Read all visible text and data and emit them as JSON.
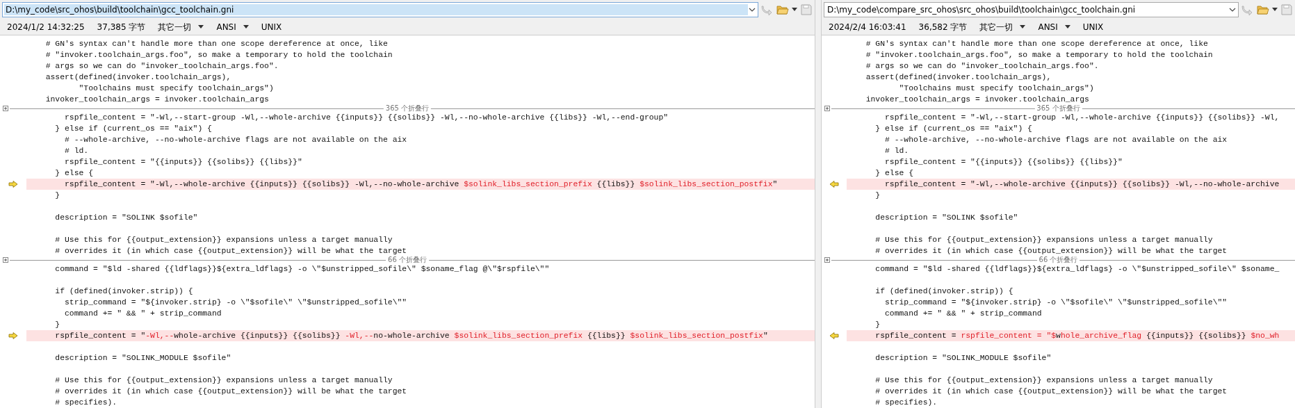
{
  "panes": [
    {
      "kind": "left",
      "active": true,
      "path": "D:\\my_code\\src_ohos\\build\\toolchain\\gcc_toolchain.gni",
      "date": "2024/1/2 14:32:25",
      "size": "37,385 字节",
      "filter": "其它一切",
      "encoding": "ANSI",
      "line_ending": "UNIX",
      "blocks": [
        {
          "kind": "code",
          "lines": [
            {
              "changed": false,
              "text": "  # GN's syntax can't handle more than one scope dereference at once, like"
            },
            {
              "changed": false,
              "text": "  # \"invoker.toolchain_args.foo\", so make a temporary to hold the toolchain"
            },
            {
              "changed": false,
              "text": "  # args so we can do \"invoker_toolchain_args.foo\"."
            },
            {
              "changed": false,
              "text": "  assert(defined(invoker.toolchain_args),"
            },
            {
              "changed": false,
              "text": "         \"Toolchains must specify toolchain_args\")"
            },
            {
              "changed": false,
              "text": "  invoker_toolchain_args = invoker.toolchain_args"
            }
          ]
        },
        {
          "kind": "fold",
          "label": "365 个折叠行"
        },
        {
          "kind": "code",
          "lines": [
            {
              "changed": false,
              "text": "      rspfile_content = \"-Wl,--start-group -Wl,--whole-archive {{inputs}} {{solibs}} -Wl,--no-whole-archive {{libs}} -Wl,--end-group\""
            },
            {
              "changed": false,
              "text": "    } else if (current_os == \"aix\") {"
            },
            {
              "changed": false,
              "text": "      # --whole-archive, --no-whole-archive flags are not available on the aix"
            },
            {
              "changed": false,
              "text": "      # ld."
            },
            {
              "changed": false,
              "text": "      rspfile_content = \"{{inputs}} {{solibs}} {{libs}}\""
            },
            {
              "changed": false,
              "text": "    } else {"
            },
            {
              "changed": true,
              "segments": [
                {
                  "text": "      rspfile_content = \"-Wl,--whole-archive {{inputs}} {{solibs}} -Wl,--no-whole-archive ",
                  "changed": false
                },
                {
                  "text": "$solink_libs_section_prefix",
                  "changed": true
                },
                {
                  "text": " {{libs}} ",
                  "changed": false
                },
                {
                  "text": "$solink_libs_section_postfix",
                  "changed": true
                },
                {
                  "text": "\"",
                  "changed": false
                }
              ]
            },
            {
              "changed": false,
              "text": "    }"
            },
            {
              "changed": false
            },
            {
              "changed": false,
              "text": "    description = \"SOLINK $sofile\""
            },
            {
              "changed": false
            },
            {
              "changed": false,
              "text": "    # Use this for {{output_extension}} expansions unless a target manually"
            },
            {
              "changed": false,
              "text": "    # overrides it (in which case {{output_extension}} will be what the target"
            }
          ]
        },
        {
          "kind": "fold",
          "label": "66 个折叠行"
        },
        {
          "kind": "code",
          "lines": [
            {
              "changed": false,
              "text": "    command = \"$ld -shared {{ldflags}}${extra_ldflags} -o \\\"$unstripped_sofile\\\" $soname_flag @\\\"$rspfile\\\"\""
            },
            {
              "changed": false
            },
            {
              "changed": false,
              "text": "    if (defined(invoker.strip)) {"
            },
            {
              "changed": false,
              "text": "      strip_command = \"${invoker.strip} -o \\\"$sofile\\\" \\\"$unstripped_sofile\\\"\""
            },
            {
              "changed": false,
              "text": "      command += \" && \" + strip_command"
            },
            {
              "changed": false,
              "text": "    }"
            },
            {
              "changed": true,
              "segments": [
                {
                  "text": "    rspfile_content = \"",
                  "changed": false
                },
                {
                  "text": "-Wl,--",
                  "changed": true
                },
                {
                  "text": "whole-archive {{inputs}} {{solibs}} ",
                  "changed": false
                },
                {
                  "text": "-Wl,--",
                  "changed": true
                },
                {
                  "text": "no-whole-archive ",
                  "changed": false
                },
                {
                  "text": "$solink_libs_section_prefix",
                  "changed": true
                },
                {
                  "text": " {{libs}} ",
                  "changed": false
                },
                {
                  "text": "$solink_libs_section_postfix",
                  "changed": true
                },
                {
                  "text": "\"",
                  "changed": false
                }
              ]
            },
            {
              "changed": false
            },
            {
              "changed": false,
              "text": "    description = \"SOLINK_MODULE $sofile\""
            },
            {
              "changed": false
            },
            {
              "changed": false,
              "text": "    # Use this for {{output_extension}} expansions unless a target manually"
            },
            {
              "changed": false,
              "text": "    # overrides it (in which case {{output_extension}} will be what the target"
            },
            {
              "changed": false,
              "text": "    # specifies)."
            }
          ]
        }
      ]
    },
    {
      "kind": "right",
      "active": false,
      "path": "D:\\my_code\\compare_src_ohos\\src_ohos\\build\\toolchain\\gcc_toolchain.gni",
      "date": "2024/2/4 16:03:41",
      "size": "36,582 字节",
      "filter": "其它一切",
      "encoding": "ANSI",
      "line_ending": "UNIX",
      "blocks": [
        {
          "kind": "code",
          "lines": [
            {
              "changed": false,
              "text": "  # GN's syntax can't handle more than one scope dereference at once, like"
            },
            {
              "changed": false,
              "text": "  # \"invoker.toolchain_args.foo\", so make a temporary to hold the toolchain"
            },
            {
              "changed": false,
              "text": "  # args so we can do \"invoker_toolchain_args.foo\"."
            },
            {
              "changed": false,
              "text": "  assert(defined(invoker.toolchain_args),"
            },
            {
              "changed": false,
              "text": "         \"Toolchains must specify toolchain_args\")"
            },
            {
              "changed": false,
              "text": "  invoker_toolchain_args = invoker.toolchain_args"
            }
          ]
        },
        {
          "kind": "fold",
          "label": "365 个折叠行"
        },
        {
          "kind": "code",
          "lines": [
            {
              "changed": false,
              "text": "      rspfile_content = \"-Wl,--start-group -Wl,--whole-archive {{inputs}} {{solibs}} -Wl,"
            },
            {
              "changed": false,
              "text": "    } else if (current_os == \"aix\") {"
            },
            {
              "changed": false,
              "text": "      # --whole-archive, --no-whole-archive flags are not available on the aix"
            },
            {
              "changed": false,
              "text": "      # ld."
            },
            {
              "changed": false,
              "text": "      rspfile_content = \"{{inputs}} {{solibs}} {{libs}}\""
            },
            {
              "changed": false,
              "text": "    } else {"
            },
            {
              "changed": true,
              "segments": [
                {
                  "text": "      rspfile_content = \"-Wl,--whole-archive {{inputs}} {{solibs}} -Wl,--no-whole-archive",
                  "changed": false
                }
              ]
            },
            {
              "changed": false,
              "text": "    }"
            },
            {
              "changed": false
            },
            {
              "changed": false,
              "text": "    description = \"SOLINK $sofile\""
            },
            {
              "changed": false
            },
            {
              "changed": false,
              "text": "    # Use this for {{output_extension}} expansions unless a target manually"
            },
            {
              "changed": false,
              "text": "    # overrides it (in which case {{output_extension}} will be what the target"
            }
          ]
        },
        {
          "kind": "fold",
          "label": "66 个折叠行"
        },
        {
          "kind": "code",
          "lines": [
            {
              "changed": false,
              "text": "    command = \"$ld -shared {{ldflags}}${extra_ldflags} -o \\\"$unstripped_sofile\\\" $soname_"
            },
            {
              "changed": false
            },
            {
              "changed": false,
              "text": "    if (defined(invoker.strip)) {"
            },
            {
              "changed": false,
              "text": "      strip_command = \"${invoker.strip} -o \\\"$sofile\\\" \\\"$unstripped_sofile\\\"\""
            },
            {
              "changed": false,
              "text": "      command += \" && \" + strip_command"
            },
            {
              "changed": false,
              "text": "    }"
            },
            {
              "changed": true,
              "segments": [
                {
                  "text": "    rspfile_content = ",
                  "changed": false
                },
                {
                  "text": "rspfile_content = \"$",
                  "changed": true
                },
                {
                  "text": "w",
                  "changed": false
                },
                {
                  "text": "hole_archive_flag",
                  "changed": true
                },
                {
                  "text": " {{inputs}} {{solibs}} ",
                  "changed": false
                },
                {
                  "text": "$no_wh",
                  "changed": true
                }
              ]
            },
            {
              "changed": false
            },
            {
              "changed": false,
              "text": "    description = \"SOLINK_MODULE $sofile\""
            },
            {
              "changed": false
            },
            {
              "changed": false,
              "text": "    # Use this for {{output_extension}} expansions unless a target manually"
            },
            {
              "changed": false,
              "text": "    # overrides it (in which case {{output_extension}} will be what the target"
            },
            {
              "changed": false,
              "text": "    # specifies)."
            }
          ]
        }
      ]
    }
  ]
}
